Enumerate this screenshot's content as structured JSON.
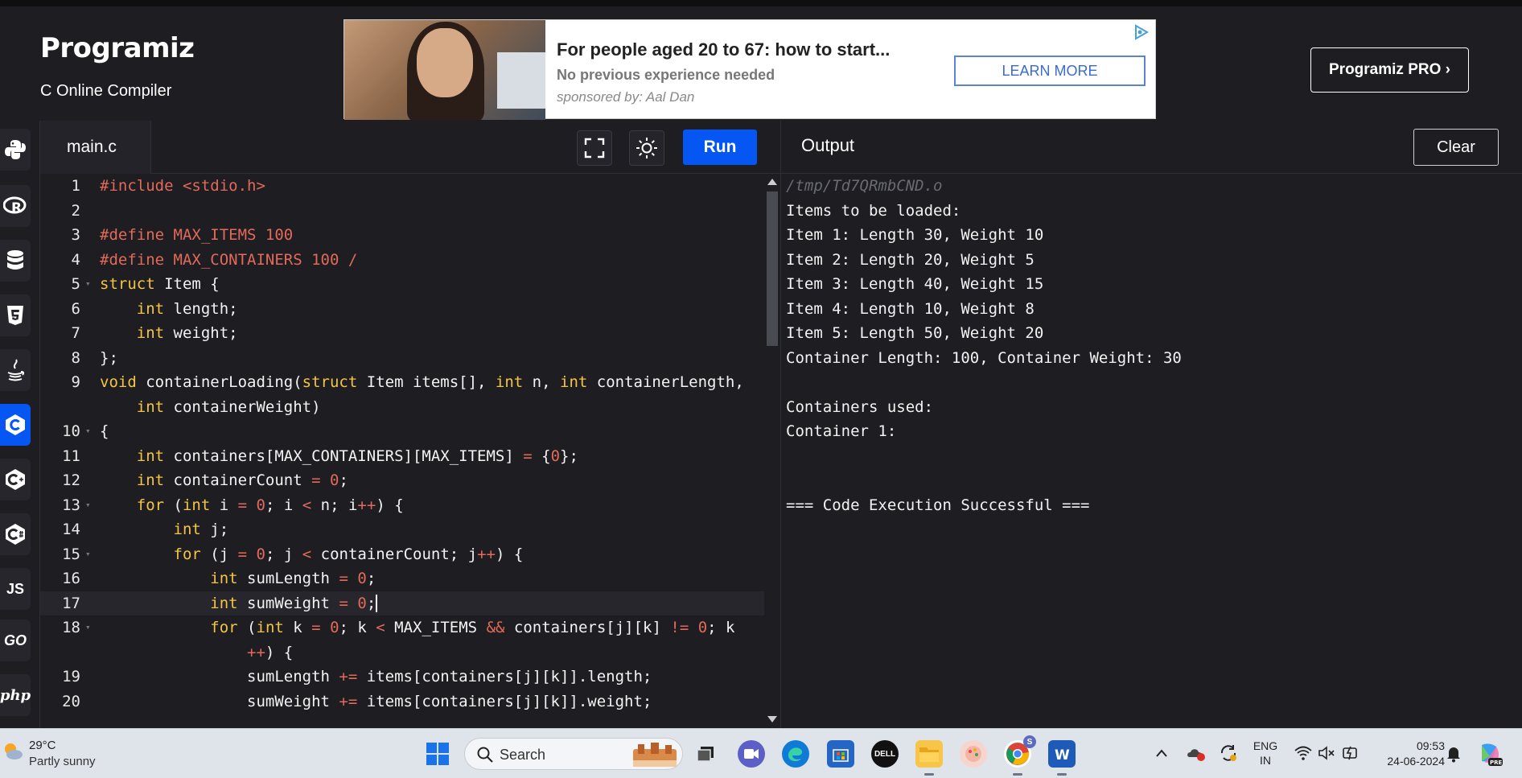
{
  "header": {
    "logo": "Programiz",
    "subtitle": "C Online Compiler",
    "pro_button": "Programiz PRO ›"
  },
  "ad": {
    "title": "For people aged 20 to 67: how to start...",
    "description": "No previous experience needed",
    "sponsor": "sponsored by: Aal Dan",
    "cta": "LEARN MORE"
  },
  "languages": [
    {
      "name": "python-icon"
    },
    {
      "name": "r-icon"
    },
    {
      "name": "sql-icon"
    },
    {
      "name": "html5-icon"
    },
    {
      "name": "java-icon"
    },
    {
      "name": "c-icon",
      "active": true
    },
    {
      "name": "cpp-icon"
    },
    {
      "name": "csharp-icon"
    },
    {
      "name": "javascript-icon",
      "label": "JS"
    },
    {
      "name": "go-icon",
      "label": "GO"
    },
    {
      "name": "php-icon",
      "label": "php"
    }
  ],
  "editor": {
    "tab": "main.c",
    "run_label": "Run",
    "line_numbers": [
      "1",
      "2",
      "3",
      "4",
      "5",
      "6",
      "7",
      "8",
      "9",
      "",
      "10",
      "11",
      "12",
      "13",
      "14",
      "15",
      "16",
      "17",
      "18",
      "",
      "19",
      "20"
    ]
  },
  "output": {
    "title": "Output",
    "clear_label": "Clear",
    "path": "/tmp/Td7QRmbCND.o",
    "lines": [
      "Items to be loaded:",
      "Item 1: Length 30, Weight 10",
      "Item 2: Length 20, Weight 5",
      "Item 3: Length 40, Weight 15",
      "Item 4: Length 10, Weight 8",
      "Item 5: Length 50, Weight 20",
      "Container Length: 100, Container Weight: 30",
      "",
      "Containers used:",
      "Container 1:",
      "",
      "",
      "=== Code Execution Successful ==="
    ]
  },
  "taskbar": {
    "weather_temp": "29°C",
    "weather_desc": "Partly sunny",
    "search_label": "Search",
    "lang_1": "ENG",
    "lang_2": "IN",
    "time": "09:53",
    "date": "24-06-2024",
    "chrome_badge": "S"
  },
  "colors": {
    "accent": "#0556f3",
    "background": "#1d1d22",
    "keyword": "#f5c542",
    "literal": "#e26a5a"
  }
}
